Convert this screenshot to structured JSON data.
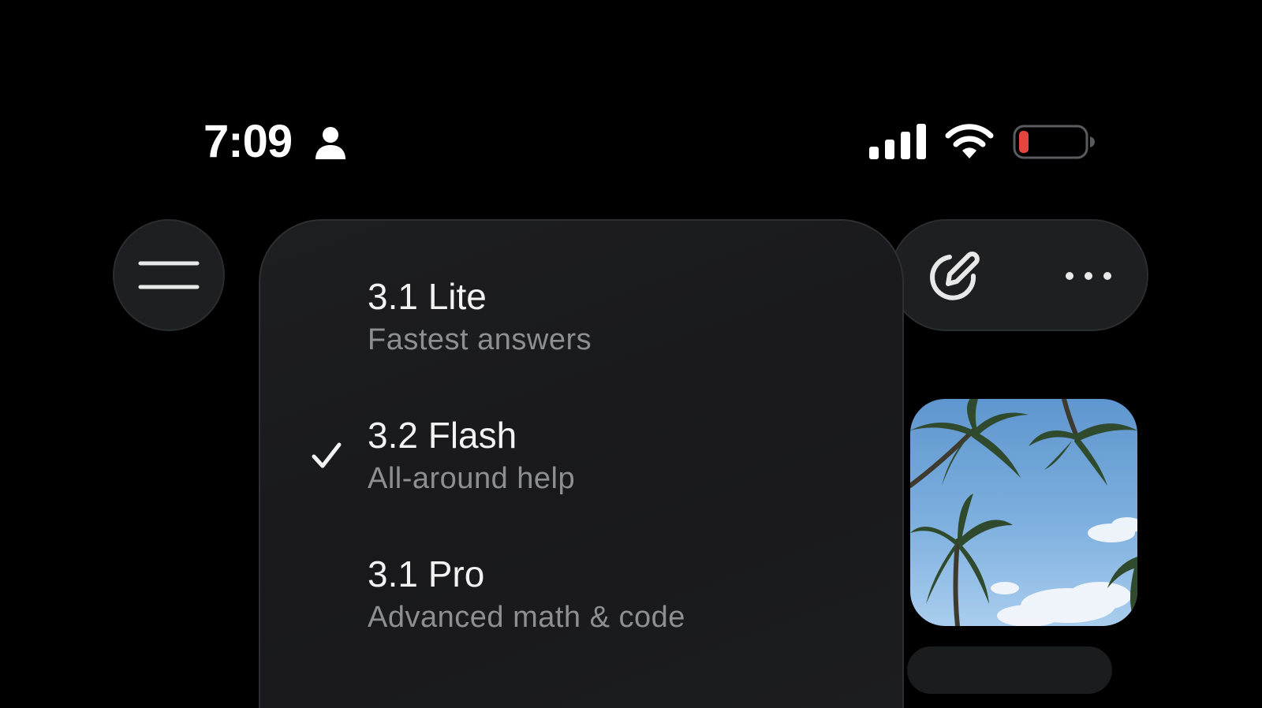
{
  "status_bar": {
    "time": "7:09",
    "person_icon": "person-icon",
    "signal_icon": "cellular-signal-icon",
    "wifi_icon": "wifi-icon",
    "battery_icon": "battery-low-icon",
    "battery_color": "#e5453d"
  },
  "top_bar": {
    "menu_icon": "hamburger-menu-icon",
    "new_chat_icon": "edit-pencil-icon",
    "more_icon": "more-horizontal-icon"
  },
  "model_menu": {
    "options": [
      {
        "name": "3.1 Lite",
        "description": "Fastest answers",
        "selected": false
      },
      {
        "name": "3.2 Flash",
        "description": "All-around help",
        "selected": true
      },
      {
        "name": "3.1 Pro",
        "description": "Advanced math & code",
        "selected": false
      }
    ],
    "check_icon": "checkmark-icon"
  },
  "content": {
    "image_icon": "palm-trees-photo"
  },
  "colors": {
    "background": "#000000",
    "surface": "#1e1f21",
    "text_primary": "#f2f2f2",
    "text_secondary": "#8e8f93"
  }
}
